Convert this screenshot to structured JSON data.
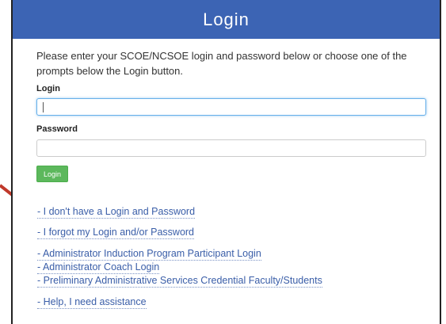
{
  "header": {
    "title": "Login"
  },
  "intro": {
    "text": "Please enter your SCOE/NCSOE login and password below or choose one of the prompts below the Login button."
  },
  "form": {
    "login_label": "Login",
    "login_value": "",
    "password_label": "Password",
    "password_value": "",
    "submit_label": "Login"
  },
  "links": [
    "- I don't have a Login and Password",
    "- I forgot my Login and/or Password",
    "- Administrator Induction Program Participant Login",
    "- Administrator Coach Login",
    "- Preliminary Administrative Services Credential Faculty/Students",
    "- Help, I need assistance"
  ],
  "colors": {
    "header_bg": "#3c64b4",
    "button_bg": "#5cb85c",
    "link": "#3a5ea8",
    "arrow": "#c0392b"
  }
}
